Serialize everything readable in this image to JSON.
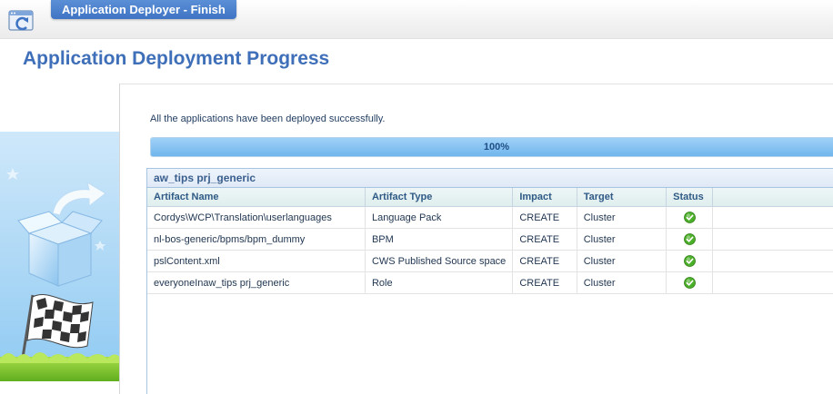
{
  "window": {
    "title": "Application Deployer - Finish"
  },
  "page": {
    "title": "Application Deployment Progress"
  },
  "status": {
    "message": "All the applications have been deployed successfully.",
    "progress_label": "100%",
    "progress_fraction": 1.0
  },
  "group": {
    "title": "aw_tips prj_generic",
    "columns": [
      "Artifact Name",
      "Artifact Type",
      "Impact",
      "Target",
      "Status"
    ],
    "rows": [
      {
        "name": "Cordys\\WCP\\Translation\\userlanguages",
        "type": "Language Pack",
        "impact": "CREATE",
        "target": "Cluster",
        "status_icon": "success-check-icon"
      },
      {
        "name": "nl-bos-generic/bpms/bpm_dummy",
        "type": "BPM",
        "impact": "CREATE",
        "target": "Cluster",
        "status_icon": "success-check-icon"
      },
      {
        "name": "pslContent.xml",
        "type": "CWS Published Source space",
        "impact": "CREATE",
        "target": "Cluster",
        "status_icon": "success-check-icon"
      },
      {
        "name": "everyoneInaw_tips prj_generic",
        "type": "Role",
        "impact": "CREATE",
        "target": "Cluster",
        "status_icon": "success-check-icon"
      }
    ]
  },
  "colors": {
    "title_tab": "#3f74c4",
    "page_title": "#3f6fb8",
    "progress_fill": "#71b6ec",
    "success": "#4caf2a"
  }
}
